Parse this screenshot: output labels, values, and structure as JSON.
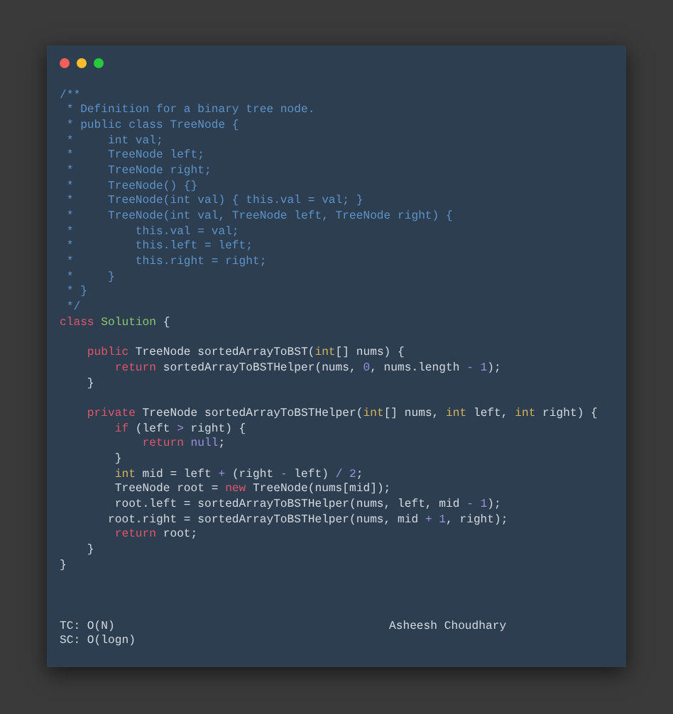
{
  "window": {
    "controls": [
      {
        "color": "#ff5f56"
      },
      {
        "color": "#ffbd2e"
      },
      {
        "color": "#27c93f"
      }
    ]
  },
  "code": {
    "lines": [
      {
        "kind": "code",
        "tokens": [
          {
            "text": "/**",
            "kind": "comment"
          }
        ]
      },
      {
        "kind": "code",
        "tokens": [
          {
            "text": " * Definition for a binary tree node.",
            "kind": "comment"
          }
        ]
      },
      {
        "kind": "code",
        "tokens": [
          {
            "text": " * public class TreeNode {",
            "kind": "comment"
          }
        ]
      },
      {
        "kind": "code",
        "tokens": [
          {
            "text": " *     int val;",
            "kind": "comment"
          }
        ]
      },
      {
        "kind": "code",
        "tokens": [
          {
            "text": " *     TreeNode left;",
            "kind": "comment"
          }
        ]
      },
      {
        "kind": "code",
        "tokens": [
          {
            "text": " *     TreeNode right;",
            "kind": "comment"
          }
        ]
      },
      {
        "kind": "code",
        "tokens": [
          {
            "text": " *     TreeNode() {}",
            "kind": "comment"
          }
        ]
      },
      {
        "kind": "code",
        "tokens": [
          {
            "text": " *     TreeNode(int val) { this.val = val; }",
            "kind": "comment"
          }
        ]
      },
      {
        "kind": "code",
        "tokens": [
          {
            "text": " *     TreeNode(int val, TreeNode left, TreeNode right) {",
            "kind": "comment"
          }
        ]
      },
      {
        "kind": "code",
        "tokens": [
          {
            "text": " *         this.val = val;",
            "kind": "comment"
          }
        ]
      },
      {
        "kind": "code",
        "tokens": [
          {
            "text": " *         this.left = left;",
            "kind": "comment"
          }
        ]
      },
      {
        "kind": "code",
        "tokens": [
          {
            "text": " *         this.right = right;",
            "kind": "comment"
          }
        ]
      },
      {
        "kind": "code",
        "tokens": [
          {
            "text": " *     }",
            "kind": "comment"
          }
        ]
      },
      {
        "kind": "code",
        "tokens": [
          {
            "text": " * }",
            "kind": "comment"
          }
        ]
      },
      {
        "kind": "code",
        "tokens": [
          {
            "text": " */",
            "kind": "comment"
          }
        ]
      },
      {
        "kind": "code",
        "tokens": [
          {
            "text": "class",
            "kind": "keyword"
          },
          {
            "text": " Solution",
            "kind": "class"
          },
          {
            "text": " {",
            "kind": "plain"
          }
        ]
      },
      {
        "kind": "blank"
      },
      {
        "kind": "code",
        "tokens": [
          {
            "text": "    public",
            "kind": "keyword"
          },
          {
            "text": " TreeNode sortedArrayToBST(",
            "kind": "plain"
          },
          {
            "text": "int",
            "kind": "type"
          },
          {
            "text": "[] nums) {",
            "kind": "plain"
          }
        ]
      },
      {
        "kind": "code",
        "tokens": [
          {
            "text": "        return",
            "kind": "keyword"
          },
          {
            "text": " sortedArrayToBSTHelper(nums, ",
            "kind": "plain"
          },
          {
            "text": "0",
            "kind": "number"
          },
          {
            "text": ", nums.length ",
            "kind": "plain"
          },
          {
            "text": "-",
            "kind": "operator"
          },
          {
            "text": " 1",
            "kind": "number"
          },
          {
            "text": ");",
            "kind": "plain"
          }
        ]
      },
      {
        "kind": "code",
        "tokens": [
          {
            "text": "    }",
            "kind": "plain"
          }
        ]
      },
      {
        "kind": "blank"
      },
      {
        "kind": "code",
        "tokens": [
          {
            "text": "    private",
            "kind": "keyword"
          },
          {
            "text": " TreeNode sortedArrayToBSTHelper(",
            "kind": "plain"
          },
          {
            "text": "int",
            "kind": "type"
          },
          {
            "text": "[] nums, ",
            "kind": "plain"
          },
          {
            "text": "int",
            "kind": "type"
          },
          {
            "text": " left, ",
            "kind": "plain"
          },
          {
            "text": "int",
            "kind": "type"
          },
          {
            "text": " right) {",
            "kind": "plain"
          }
        ]
      },
      {
        "kind": "code",
        "tokens": [
          {
            "text": "        if",
            "kind": "keyword"
          },
          {
            "text": " (left ",
            "kind": "plain"
          },
          {
            "text": ">",
            "kind": "operator"
          },
          {
            "text": " right) {",
            "kind": "plain"
          }
        ]
      },
      {
        "kind": "code",
        "tokens": [
          {
            "text": "            return",
            "kind": "keyword"
          },
          {
            "text": " null",
            "kind": "number"
          },
          {
            "text": ";",
            "kind": "plain"
          }
        ]
      },
      {
        "kind": "code",
        "tokens": [
          {
            "text": "        }",
            "kind": "plain"
          }
        ]
      },
      {
        "kind": "code",
        "tokens": [
          {
            "text": "        int",
            "kind": "type"
          },
          {
            "text": " mid = left ",
            "kind": "plain"
          },
          {
            "text": "+",
            "kind": "operator"
          },
          {
            "text": " (right ",
            "kind": "plain"
          },
          {
            "text": "-",
            "kind": "operator"
          },
          {
            "text": " left) ",
            "kind": "plain"
          },
          {
            "text": "/",
            "kind": "operator"
          },
          {
            "text": " 2",
            "kind": "number"
          },
          {
            "text": ";",
            "kind": "plain"
          }
        ]
      },
      {
        "kind": "code",
        "tokens": [
          {
            "text": "        TreeNode root = ",
            "kind": "plain"
          },
          {
            "text": "new",
            "kind": "keyword"
          },
          {
            "text": " TreeNode(nums[mid]);",
            "kind": "plain"
          }
        ]
      },
      {
        "kind": "code",
        "tokens": [
          {
            "text": "        root.left = sortedArrayToBSTHelper(nums, left, mid ",
            "kind": "plain"
          },
          {
            "text": "-",
            "kind": "operator"
          },
          {
            "text": " 1",
            "kind": "number"
          },
          {
            "text": ");",
            "kind": "plain"
          }
        ]
      },
      {
        "kind": "code",
        "tokens": [
          {
            "text": "       root.right = sortedArrayToBSTHelper(nums, mid ",
            "kind": "plain"
          },
          {
            "text": "+",
            "kind": "operator"
          },
          {
            "text": " 1",
            "kind": "number"
          },
          {
            "text": ", right);",
            "kind": "plain"
          }
        ]
      },
      {
        "kind": "code",
        "tokens": [
          {
            "text": "        return",
            "kind": "keyword"
          },
          {
            "text": " root;",
            "kind": "plain"
          }
        ]
      },
      {
        "kind": "code",
        "tokens": [
          {
            "text": "    }",
            "kind": "plain"
          }
        ]
      },
      {
        "kind": "code",
        "tokens": [
          {
            "text": "}",
            "kind": "plain"
          }
        ]
      }
    ]
  },
  "footer": {
    "complexity": [
      "TC: O(N)",
      "SC: O(logn)"
    ],
    "author": "Asheesh Choudhary"
  }
}
